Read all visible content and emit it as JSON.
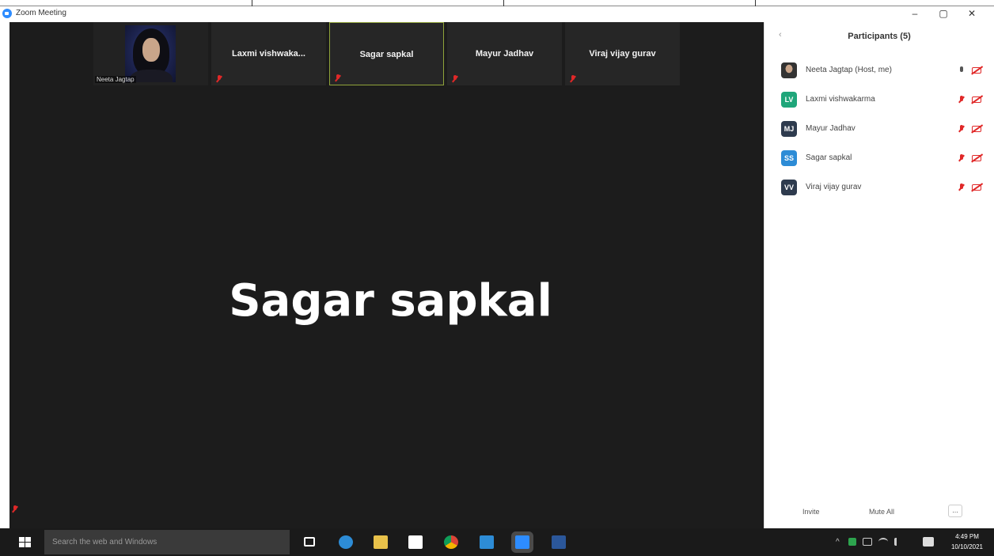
{
  "window": {
    "title": "Zoom Meeting"
  },
  "window_controls": {
    "minimize": "–",
    "maximize": "▢",
    "close": "✕"
  },
  "thumbnails": [
    {
      "name": "Neeta Jagtap",
      "has_photo": true
    },
    {
      "name": "Laxmi  vishwaka..."
    },
    {
      "name": "Sagar sapkal",
      "active": true
    },
    {
      "name": "Mayur Jadhav"
    },
    {
      "name": "Viraj vijay gurav"
    }
  ],
  "active_speaker": {
    "name": "Sagar sapkal"
  },
  "participants_panel": {
    "collapse_icon": "‹",
    "title": "Participants (5)",
    "participants": [
      {
        "name": "Neeta Jagtap (Host, me)",
        "initials": "",
        "avatar_color": "#555555",
        "mic": "on"
      },
      {
        "name": "Laxmi vishwakarma",
        "initials": "LV",
        "avatar_color": "#1fa67a",
        "mic": "off"
      },
      {
        "name": "Mayur Jadhav",
        "initials": "MJ",
        "avatar_color": "#2e3b4e",
        "mic": "off"
      },
      {
        "name": "Sagar sapkal",
        "initials": "SS",
        "avatar_color": "#2d8cd6",
        "mic": "off"
      },
      {
        "name": "Viraj vijay gurav",
        "initials": "VV",
        "avatar_color": "#2e3b4e",
        "mic": "off"
      }
    ],
    "invite_label": "Invite",
    "mute_all_label": "Mute All",
    "more_label": "..."
  },
  "taskbar": {
    "search_placeholder": "Search the web and Windows",
    "apps": [
      {
        "icon": "task-view-icon",
        "color": "#ffffff"
      },
      {
        "icon": "edge-icon",
        "color": "#2d8cd6"
      },
      {
        "icon": "file-explorer-icon",
        "color": "#e8c14a"
      },
      {
        "icon": "store-icon",
        "color": "#ffffff"
      },
      {
        "icon": "chrome-icon",
        "color": "#f2b824"
      },
      {
        "icon": "mail-icon",
        "color": "#2d8cd6"
      },
      {
        "icon": "zoom-icon",
        "color": "#2d8cff"
      },
      {
        "icon": "word-icon",
        "color": "#2b579a"
      }
    ],
    "tray": "^",
    "time": "4:49 PM",
    "date": "10/10/2021"
  }
}
